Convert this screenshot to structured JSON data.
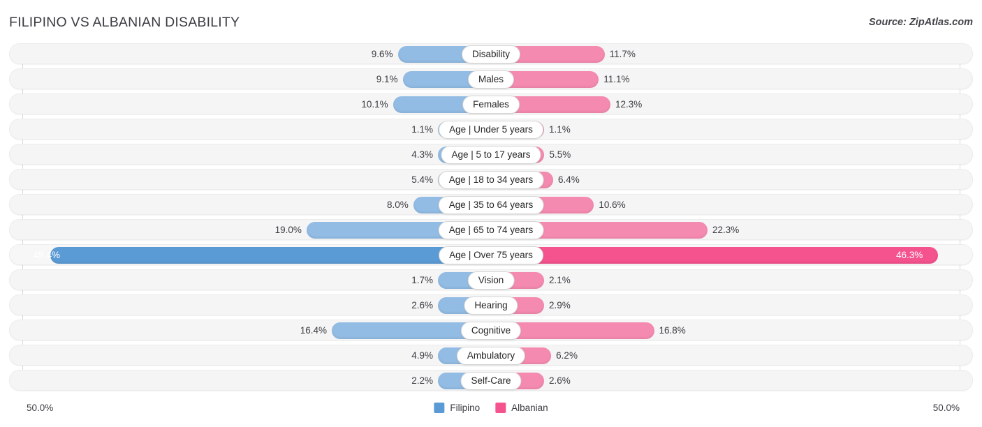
{
  "header": {
    "title": "FILIPINO VS ALBANIAN DISABILITY",
    "source": "Source: ZipAtlas.com"
  },
  "axis": {
    "left_label": "50.0%",
    "right_label": "50.0%",
    "max": 50.0
  },
  "legend": {
    "items": [
      {
        "label": "Filipino",
        "color": "#5b9bd5"
      },
      {
        "label": "Albanian",
        "color": "#f4538e"
      }
    ]
  },
  "colors": {
    "left_normal": "#92bce4",
    "right_normal": "#f58ab0",
    "left_highlight": "#5b9bd5",
    "right_highlight": "#f4538e",
    "row_background": "#f5f5f5",
    "text": "#3c3c43"
  },
  "chart_data": {
    "type": "bar",
    "title": "FILIPINO VS ALBANIAN DISABILITY",
    "subtitle": "Source: ZipAtlas.com",
    "orientation": "horizontal-diverging",
    "xlabel": "",
    "ylabel": "",
    "xlim": [
      50.0,
      50.0
    ],
    "grid": true,
    "legend_position": "bottom-center",
    "categories": [
      "Disability",
      "Males",
      "Females",
      "Age | Under 5 years",
      "Age | 5 to 17 years",
      "Age | 18 to 34 years",
      "Age | 35 to 64 years",
      "Age | 65 to 74 years",
      "Age | Over 75 years",
      "Vision",
      "Hearing",
      "Cognitive",
      "Ambulatory",
      "Self-Care"
    ],
    "series": [
      {
        "name": "Filipino",
        "values": [
          9.6,
          9.1,
          10.1,
          1.1,
          4.3,
          5.4,
          8.0,
          19.0,
          45.4,
          1.7,
          2.6,
          16.4,
          4.9,
          2.2
        ]
      },
      {
        "name": "Albanian",
        "values": [
          11.7,
          11.1,
          12.3,
          1.1,
          5.5,
          6.4,
          10.6,
          22.3,
          46.3,
          2.1,
          2.9,
          16.8,
          6.2,
          2.6
        ]
      }
    ]
  },
  "rows": [
    {
      "label": "Disability",
      "left": "9.6%",
      "right": "11.7%",
      "left_v": 9.6,
      "right_v": 11.7,
      "highlight": false
    },
    {
      "label": "Males",
      "left": "9.1%",
      "right": "11.1%",
      "left_v": 9.1,
      "right_v": 11.1,
      "highlight": false
    },
    {
      "label": "Females",
      "left": "10.1%",
      "right": "12.3%",
      "left_v": 10.1,
      "right_v": 12.3,
      "highlight": false
    },
    {
      "label": "Age | Under 5 years",
      "left": "1.1%",
      "right": "1.1%",
      "left_v": 1.1,
      "right_v": 1.1,
      "highlight": false
    },
    {
      "label": "Age | 5 to 17 years",
      "left": "4.3%",
      "right": "5.5%",
      "left_v": 4.3,
      "right_v": 5.5,
      "highlight": false
    },
    {
      "label": "Age | 18 to 34 years",
      "left": "5.4%",
      "right": "6.4%",
      "left_v": 5.4,
      "right_v": 6.4,
      "highlight": false
    },
    {
      "label": "Age | 35 to 64 years",
      "left": "8.0%",
      "right": "10.6%",
      "left_v": 8.0,
      "right_v": 10.6,
      "highlight": false
    },
    {
      "label": "Age | 65 to 74 years",
      "left": "19.0%",
      "right": "22.3%",
      "left_v": 19.0,
      "right_v": 22.3,
      "highlight": false
    },
    {
      "label": "Age | Over 75 years",
      "left": "45.4%",
      "right": "46.3%",
      "left_v": 45.4,
      "right_v": 46.3,
      "highlight": true
    },
    {
      "label": "Vision",
      "left": "1.7%",
      "right": "2.1%",
      "left_v": 1.7,
      "right_v": 2.1,
      "highlight": false
    },
    {
      "label": "Hearing",
      "left": "2.6%",
      "right": "2.9%",
      "left_v": 2.6,
      "right_v": 2.9,
      "highlight": false
    },
    {
      "label": "Cognitive",
      "left": "16.4%",
      "right": "16.8%",
      "left_v": 16.4,
      "right_v": 16.8,
      "highlight": false
    },
    {
      "label": "Ambulatory",
      "left": "4.9%",
      "right": "6.2%",
      "left_v": 4.9,
      "right_v": 6.2,
      "highlight": false
    },
    {
      "label": "Self-Care",
      "left": "2.2%",
      "right": "2.6%",
      "left_v": 2.2,
      "right_v": 2.6,
      "highlight": false
    }
  ]
}
